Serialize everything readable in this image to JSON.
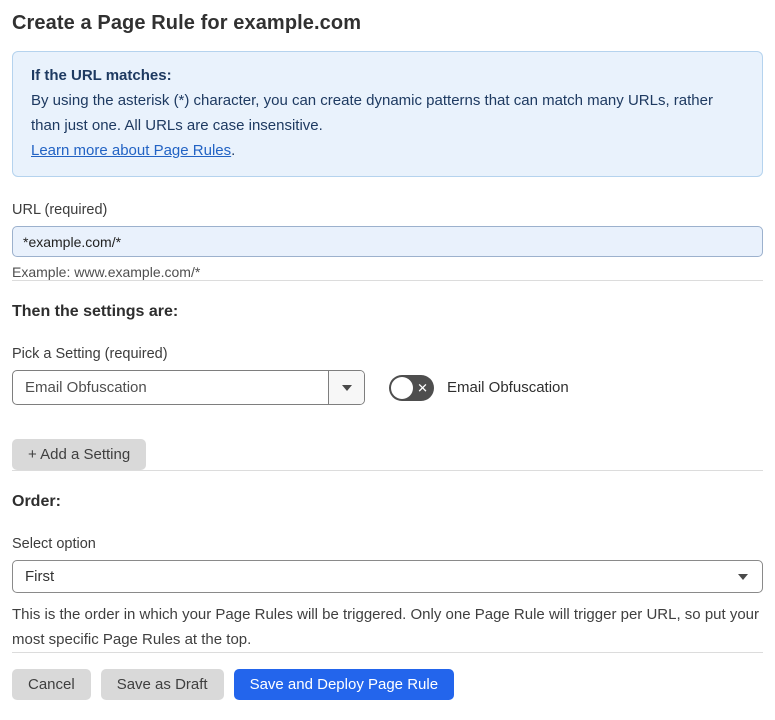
{
  "page": {
    "title": "Create a Page Rule for example.com"
  },
  "info_box": {
    "heading": "If the URL matches:",
    "body": "By using the asterisk (*) character, you can create dynamic patterns that can match many URLs, rather than just one. All URLs are case insensitive.",
    "link_label": "Learn more about Page Rules",
    "link_suffix": "."
  },
  "url_field": {
    "label": "URL (required)",
    "value": "*example.com/*",
    "helper": "Example: www.example.com/*"
  },
  "settings_section": {
    "heading": "Then the settings are:",
    "picker_label": "Pick a Setting (required)",
    "picker_value": "Email Obfuscation",
    "toggle_label": "Email Obfuscation",
    "toggle_state": "off",
    "toggle_glyph": "✕",
    "add_button_label": "+ Add a Setting"
  },
  "order_section": {
    "heading": "Order:",
    "select_label": "Select option",
    "select_value": "First",
    "helper": "This is the order in which your Page Rules will be triggered. Only one Page Rule will trigger per URL, so put your most specific Page Rules at the top."
  },
  "footer": {
    "cancel_label": "Cancel",
    "save_draft_label": "Save as Draft",
    "save_deploy_label": "Save and Deploy Page Rule"
  },
  "colors": {
    "accent_blue": "#2365ec",
    "info_bg": "#e9f2fc",
    "info_border": "#b5d3ee",
    "info_text": "#1e3a61",
    "link_blue": "#2263c4",
    "input_bg": "#e9f1fc",
    "gray_button_bg": "#d9d9d9",
    "toggle_off_bg": "#4e4e4e"
  }
}
